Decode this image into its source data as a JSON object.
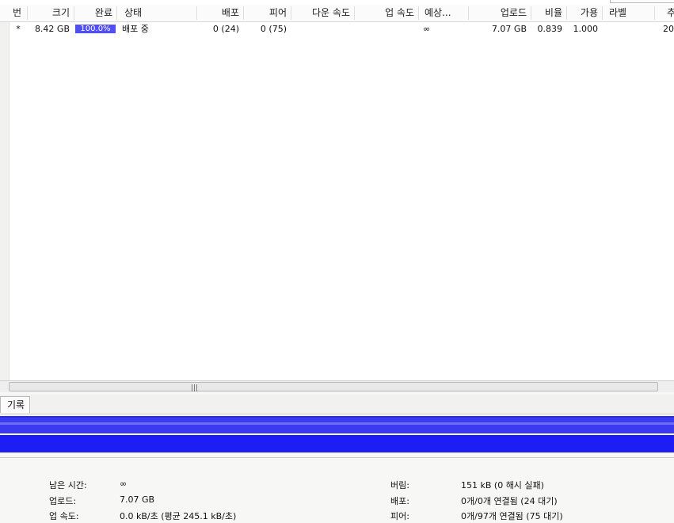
{
  "columns": {
    "num": "번",
    "size": "크기",
    "done": "완료",
    "status": "상태",
    "seeds": "배포",
    "peers": "피어",
    "down_speed": "다운 속도",
    "up_speed": "업 속도",
    "eta": "예상...",
    "uploaded": "업로드",
    "ratio": "비율",
    "availability": "가용",
    "label": "라벨",
    "added": "추"
  },
  "torrents": [
    {
      "num": "*",
      "size": "8.42 GB",
      "done": "100.0%",
      "done_fraction": 1.0,
      "status": "배포 중",
      "seeds": "0 (24)",
      "peers": "0 (75)",
      "down_speed": "",
      "up_speed": "",
      "eta": "∞",
      "uploaded": "7.07 GB",
      "ratio": "0.839",
      "availability": "1.000",
      "label": "",
      "added": "20"
    }
  ],
  "tabs": {
    "log": "기록"
  },
  "colors": {
    "progress": "#4f4ff5",
    "bar_dark": "#1d1df5",
    "bar_light": "#3a3af0"
  },
  "stats": {
    "left": [
      {
        "label": "남은 시간:",
        "value": "∞"
      },
      {
        "label": "업로드:",
        "value": "7.07 GB"
      },
      {
        "label": "업 속도:",
        "value": "0.0 kB/초 (평균 245.1 kB/초)"
      }
    ],
    "right": [
      {
        "label": "버림:",
        "value": "151 kB (0 해시 실패)"
      },
      {
        "label": "배포:",
        "value": "0개/0개 연결됨 (24 대기)"
      },
      {
        "label": "피어:",
        "value": "0개/97개 연결됨 (75 대기)"
      }
    ]
  }
}
